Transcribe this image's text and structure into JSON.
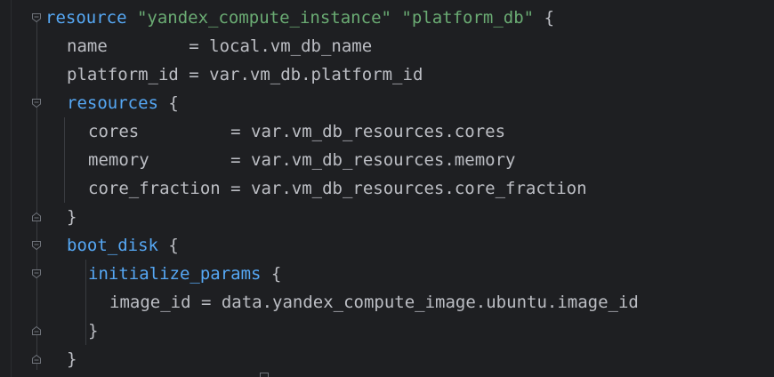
{
  "code": {
    "lines": [
      {
        "indent": 0,
        "tokens": [
          {
            "t": "resource",
            "c": "kw"
          },
          {
            "t": " ",
            "c": "plain"
          },
          {
            "t": "\"yandex_compute_instance\"",
            "c": "str"
          },
          {
            "t": " ",
            "c": "plain"
          },
          {
            "t": "\"platform_db\"",
            "c": "str"
          },
          {
            "t": " {",
            "c": "plain"
          }
        ]
      },
      {
        "indent": 1,
        "tokens": [
          {
            "t": "name",
            "c": "prop"
          },
          {
            "t": "        = local.vm_db_name",
            "c": "plain"
          }
        ]
      },
      {
        "indent": 1,
        "tokens": [
          {
            "t": "platform_id",
            "c": "prop"
          },
          {
            "t": " = var.vm_db.platform_id",
            "c": "plain"
          }
        ]
      },
      {
        "indent": 1,
        "tokens": [
          {
            "t": "resources",
            "c": "kw"
          },
          {
            "t": " {",
            "c": "plain"
          }
        ]
      },
      {
        "indent": 2,
        "tokens": [
          {
            "t": "cores",
            "c": "prop"
          },
          {
            "t": "         = var.vm_db_resources.cores",
            "c": "plain"
          }
        ]
      },
      {
        "indent": 2,
        "tokens": [
          {
            "t": "memory",
            "c": "prop"
          },
          {
            "t": "        = var.vm_db_resources.memory",
            "c": "plain"
          }
        ]
      },
      {
        "indent": 2,
        "tokens": [
          {
            "t": "core_fraction",
            "c": "prop"
          },
          {
            "t": " = var.vm_db_resources.core_fraction",
            "c": "plain"
          }
        ]
      },
      {
        "indent": 1,
        "tokens": [
          {
            "t": "}",
            "c": "plain"
          }
        ]
      },
      {
        "indent": 1,
        "tokens": [
          {
            "t": "boot_disk",
            "c": "kw"
          },
          {
            "t": " {",
            "c": "plain"
          }
        ]
      },
      {
        "indent": 2,
        "tokens": [
          {
            "t": "initialize_params",
            "c": "kw"
          },
          {
            "t": " {",
            "c": "plain"
          }
        ]
      },
      {
        "indent": 3,
        "tokens": [
          {
            "t": "image_id",
            "c": "prop"
          },
          {
            "t": " = data.yandex_compute_image.ubuntu.image_id",
            "c": "plain"
          }
        ]
      },
      {
        "indent": 2,
        "tokens": [
          {
            "t": "}",
            "c": "plain"
          }
        ]
      },
      {
        "indent": 1,
        "tokens": [
          {
            "t": "}",
            "c": "plain"
          }
        ]
      }
    ]
  },
  "fold_markers": [
    {
      "line": 0,
      "kind": "open"
    },
    {
      "line": 3,
      "kind": "open"
    },
    {
      "line": 7,
      "kind": "close"
    },
    {
      "line": 8,
      "kind": "open"
    },
    {
      "line": 9,
      "kind": "open"
    },
    {
      "line": 11,
      "kind": "close"
    },
    {
      "line": 12,
      "kind": "close"
    }
  ],
  "colors": {
    "background": "#1e1f22",
    "keyword": "#56a8f5",
    "string": "#6aab73",
    "text": "#bcbec4"
  }
}
